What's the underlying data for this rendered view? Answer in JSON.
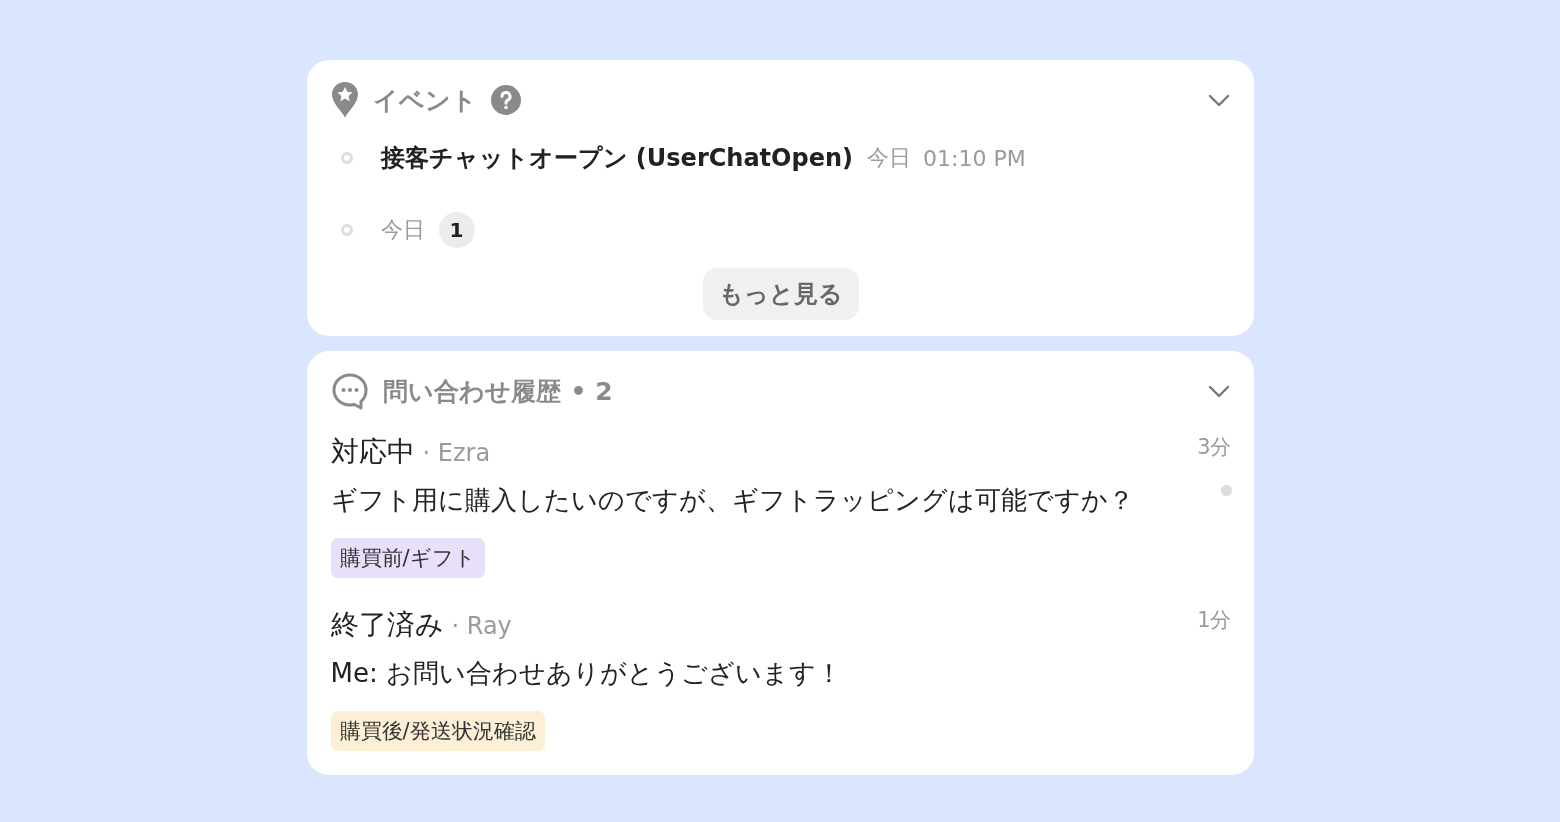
{
  "events": {
    "title": "イベント",
    "expanded": true,
    "items": [
      {
        "kind": "event",
        "name": "接客チャットオープン (UserChatOpen)",
        "day": "今日",
        "time": "01:10 PM"
      },
      {
        "kind": "group",
        "day": "今日",
        "count": "1"
      }
    ],
    "more_button": "もっと見る"
  },
  "history": {
    "title": "問い合わせ履歴",
    "count": "• 2",
    "expanded": true,
    "chats": [
      {
        "status": "対応中",
        "assignee": "· Ezra",
        "ago": "3分",
        "unread": true,
        "message": "ギフト用に購入したいのですが、ギフトラッピングは可能ですか？",
        "tag": {
          "label": "購買前/ギフト",
          "color": "#e8dffa"
        }
      },
      {
        "status": "終了済み",
        "assignee": "· Ray",
        "ago": "1分",
        "unread": false,
        "message": "Me: お問い合わせありがとうございます！",
        "tag": {
          "label": "購買後/発送状況確認",
          "color": "#fcefd6"
        }
      }
    ]
  }
}
